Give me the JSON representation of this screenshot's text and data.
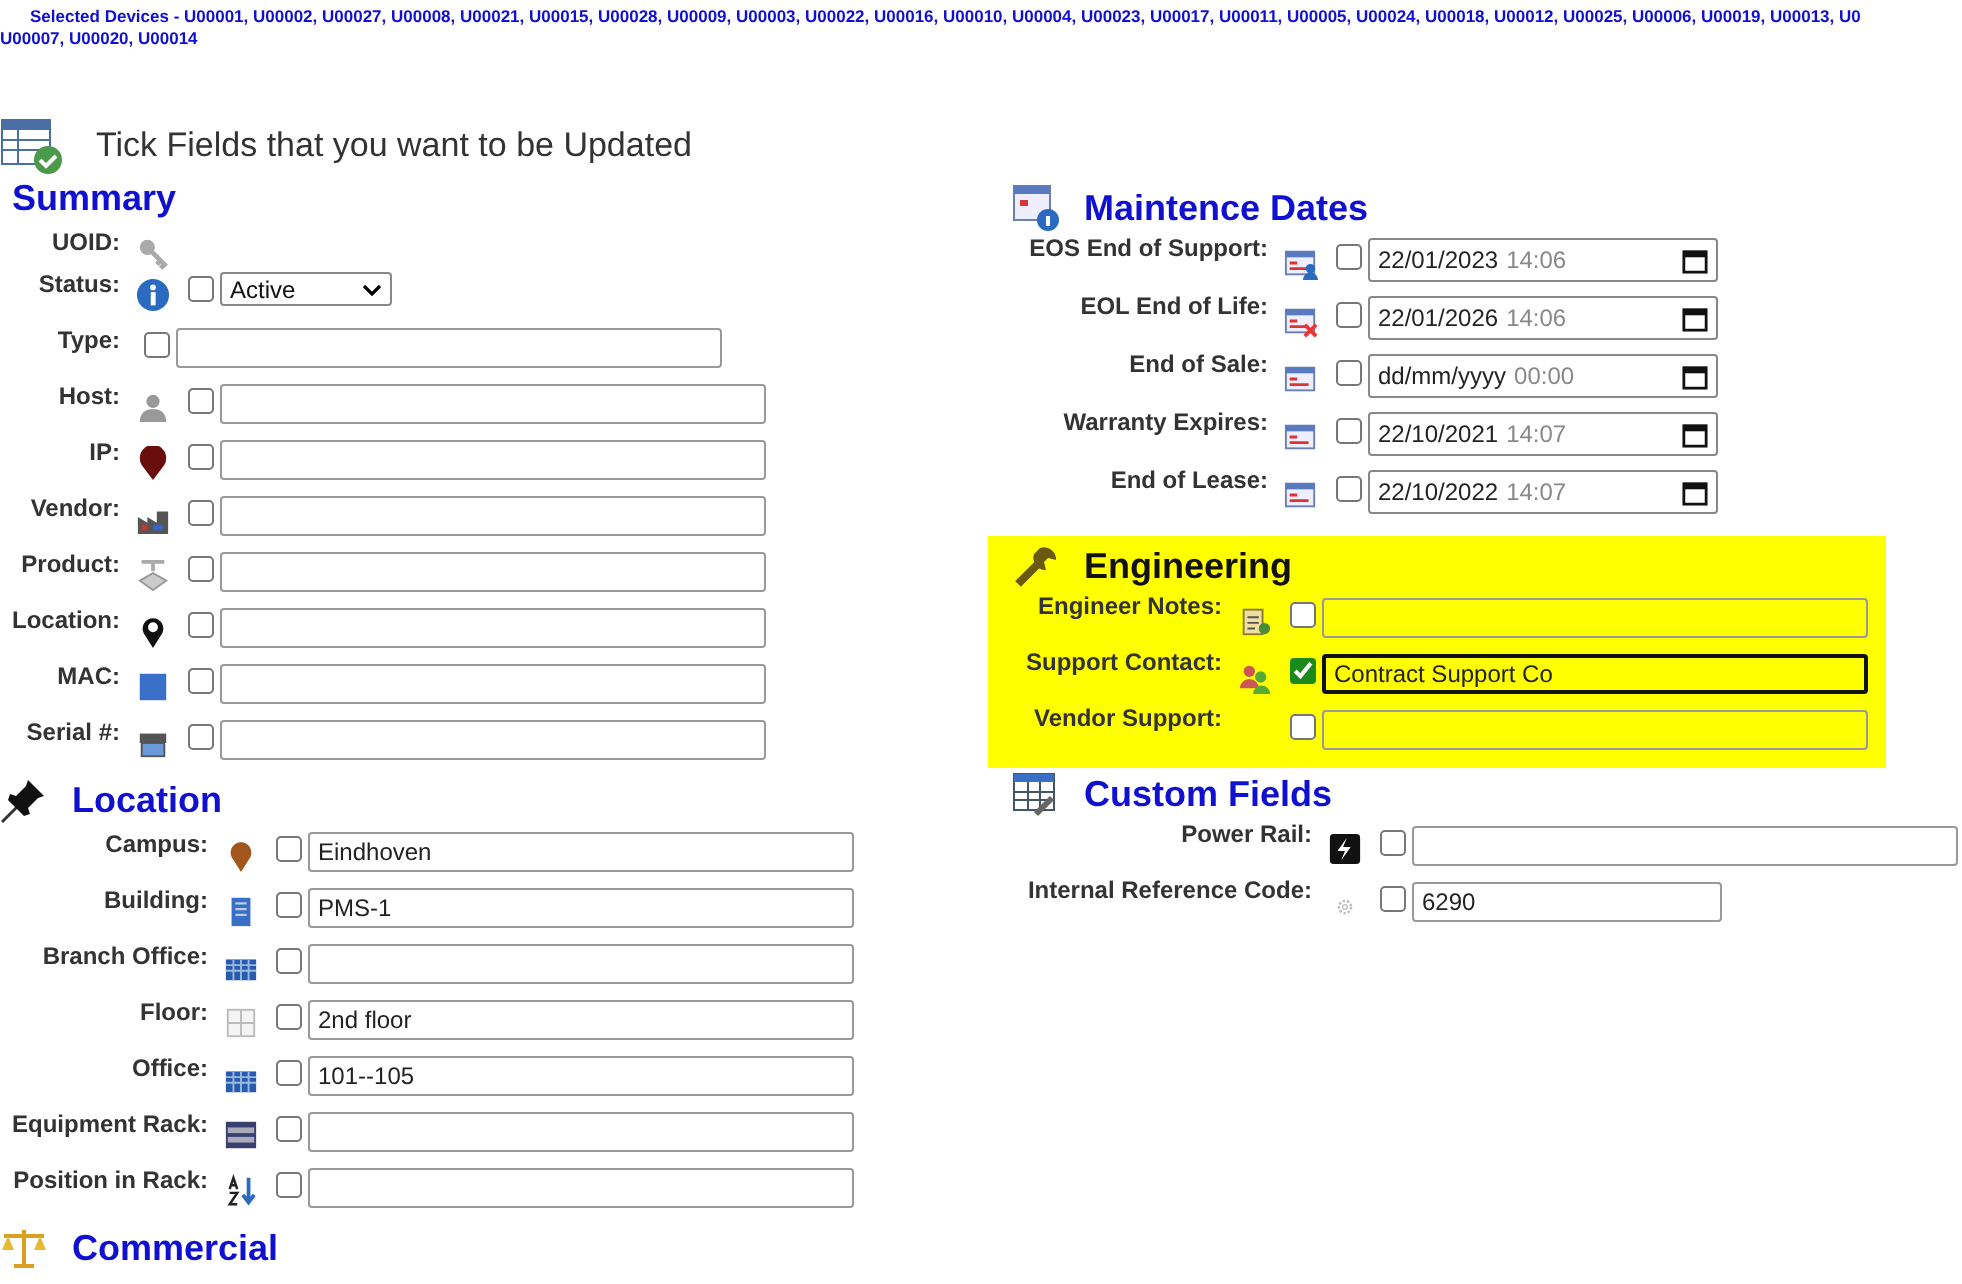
{
  "selection": {
    "line_1": "Selected Devices - U00001, U00002, U00027, U00008, U00021, U00015, U00028, U00009, U00003, U00022, U00016, U00010, U00004, U00023, U00017, U00011, U00005, U00024, U00018, U00012, U00025, U00006, U00019, U00013, U0",
    "line_2": "U00007, U00020, U00014"
  },
  "title": "Tick Fields that you want to be Updated",
  "columns": [
    {
      "sections": [
        {
          "kind": "summary",
          "heading": "Summary",
          "highlighted": false,
          "fields": [
            {
              "label": "UOID:",
              "kind": "static"
            },
            {
              "label": "Status:",
              "kind": "select",
              "checked": false,
              "value": "Active"
            },
            {
              "label": "Type:",
              "kind": "text",
              "checked": false
            },
            {
              "label": "Host:",
              "kind": "text",
              "checked": false
            },
            {
              "label": "IP:",
              "kind": "text",
              "checked": false
            },
            {
              "label": "Vendor:",
              "kind": "text",
              "checked": false
            },
            {
              "label": "Product:",
              "kind": "text",
              "checked": false
            },
            {
              "label": "Location:",
              "kind": "text",
              "checked": false
            },
            {
              "label": "MAC:",
              "kind": "text",
              "checked": false
            },
            {
              "label": "Serial #:",
              "kind": "text",
              "checked": false
            }
          ]
        },
        {
          "kind": "location",
          "heading": "Location",
          "highlighted": false,
          "fields": [
            {
              "label": "Campus:",
              "kind": "text",
              "checked": false,
              "value": "Eindhoven"
            },
            {
              "label": "Building:",
              "kind": "text",
              "checked": false,
              "value": "PMS-1"
            },
            {
              "label": "Branch Office:",
              "kind": "text",
              "checked": false
            },
            {
              "label": "Floor:",
              "kind": "text",
              "checked": false,
              "value": "2nd floor"
            },
            {
              "label": "Office:",
              "kind": "text",
              "checked": false,
              "value": "101--105"
            },
            {
              "label": "Equipment Rack:",
              "kind": "text",
              "checked": false
            },
            {
              "label": "Position in Rack:",
              "kind": "text",
              "checked": false
            }
          ]
        },
        {
          "kind": "commercial",
          "heading": "Commercial",
          "highlighted": false
        }
      ]
    },
    {
      "sections": [
        {
          "kind": "dates",
          "heading": "Maintence Dates",
          "highlighted": false,
          "fields": [
            {
              "label": "EOS End of Support:",
              "kind": "datetime",
              "checked": false,
              "date": "22/01/2023",
              "time": "14:06"
            },
            {
              "label": "EOL End of Life:",
              "kind": "datetime",
              "checked": false,
              "date": "22/01/2026",
              "time": "14:06"
            },
            {
              "label": "End of Sale:",
              "kind": "datetime",
              "checked": false,
              "date_placeholder": "dd/mm/yyyy",
              "time_placeholder": "00:00"
            },
            {
              "label": "Warranty Expires:",
              "kind": "datetime",
              "checked": false,
              "date": "22/10/2021",
              "time": "14:07"
            },
            {
              "label": "End of Lease:",
              "kind": "datetime",
              "checked": false,
              "date": "22/10/2022",
              "time": "14:07"
            }
          ]
        },
        {
          "kind": "engineering",
          "heading": "Engineering",
          "highlighted": true,
          "fields": [
            {
              "label": "Engineer Notes:",
              "kind": "text",
              "checked": false,
              "focused": false
            },
            {
              "label": "Support Contact:",
              "kind": "text",
              "checked": true,
              "focused": true,
              "value": "Contract Support Co"
            },
            {
              "label": "Vendor Support:",
              "kind": "text",
              "checked": false,
              "focused": false
            }
          ]
        },
        {
          "kind": "custom",
          "heading": "Custom Fields",
          "highlighted": false,
          "fields": [
            {
              "label": "Power Rail:",
              "kind": "text",
              "checked": false
            },
            {
              "label": "Internal Reference Code:",
              "kind": "number",
              "checked": false,
              "value": "6290"
            }
          ]
        }
      ]
    }
  ]
}
